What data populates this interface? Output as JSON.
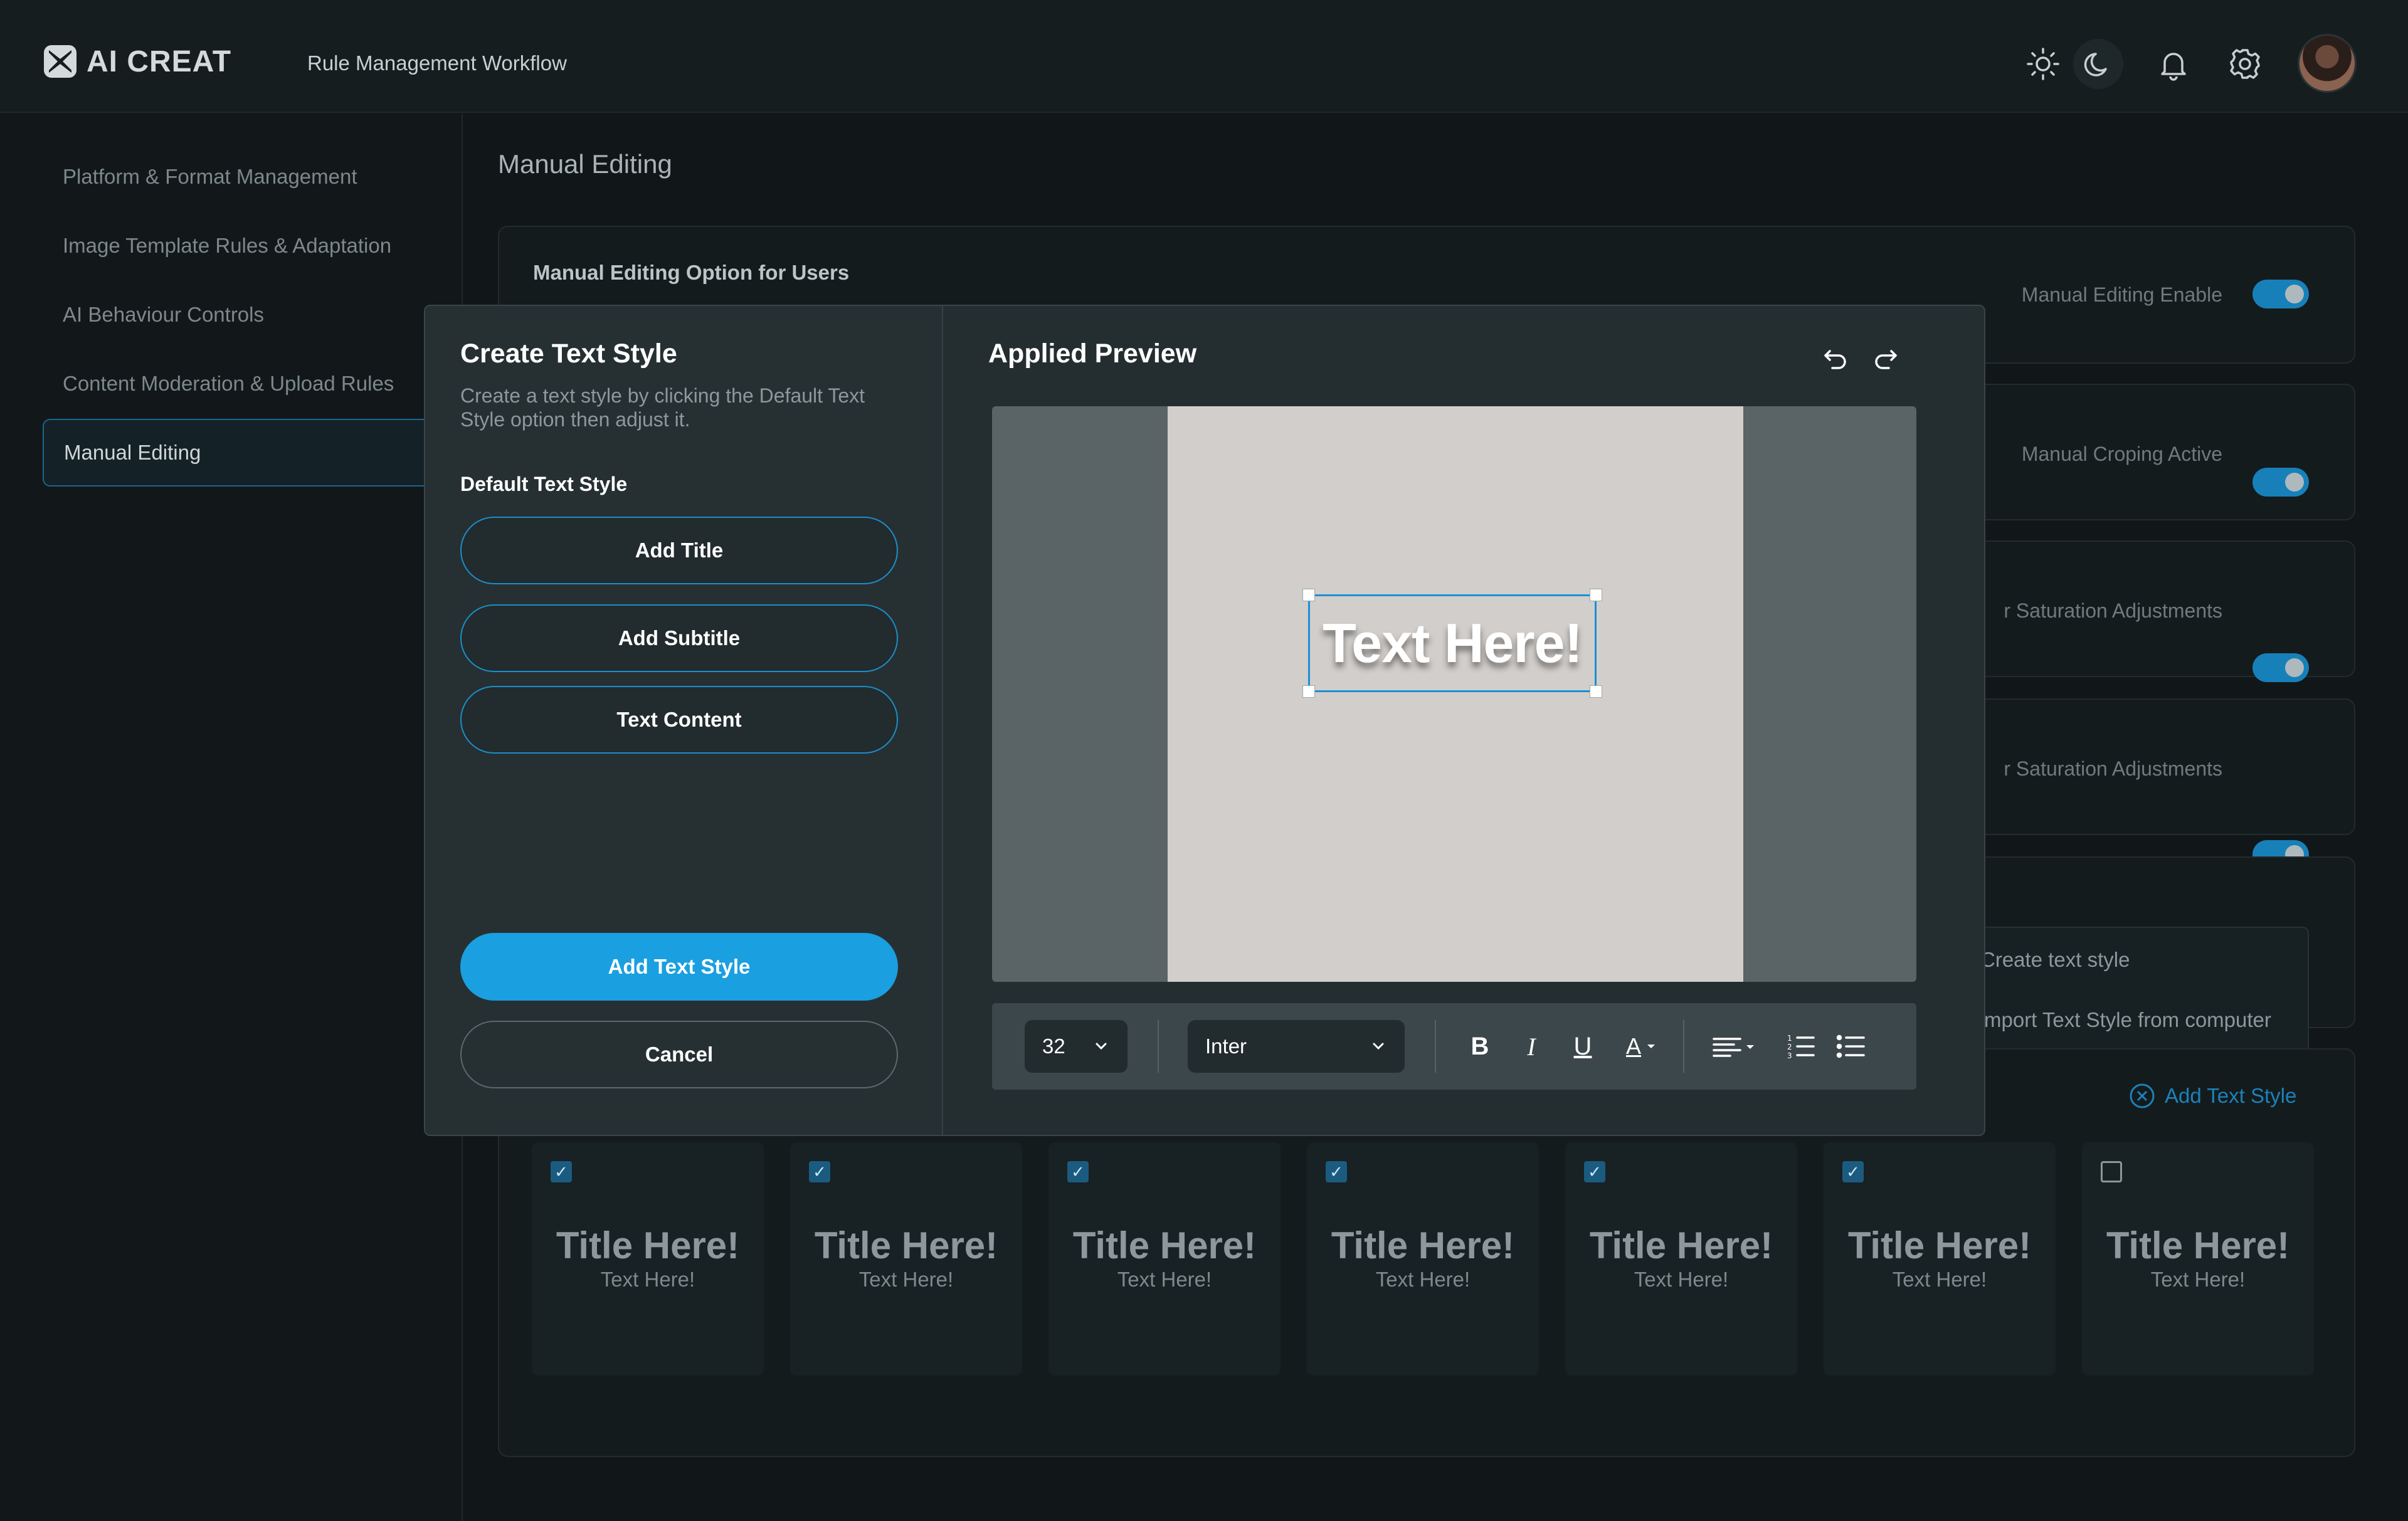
{
  "header": {
    "logo_text": "AI CREAT",
    "app_title": "Rule Management Workflow",
    "icons": [
      "sun-icon",
      "moon-icon",
      "bell-icon",
      "gear-icon"
    ]
  },
  "sidebar": {
    "items": [
      {
        "label": "Platform & Format Management"
      },
      {
        "label": "Image Template Rules & Adaptation"
      },
      {
        "label": "AI Behaviour Controls"
      },
      {
        "label": "Content Moderation & Upload Rules"
      },
      {
        "label": "Manual Editing",
        "active": true
      }
    ]
  },
  "main": {
    "title": "Manual Editing",
    "section_label": "Manual Editing Option for Users",
    "toggles": [
      {
        "label": "Manual Editing Enable",
        "on": true
      },
      {
        "label": "Manual Croping Active",
        "on": true
      },
      {
        "label": "r Saturation Adjustments",
        "on": true
      },
      {
        "label": "r Saturation Adjustments",
        "on": true
      }
    ],
    "menu": {
      "create": "Create text style",
      "import": "mport Text Style from computer"
    },
    "add_text_style_link": "Add Text Style",
    "tiles": [
      {
        "title": "Title Here!",
        "text": "Text Here!",
        "checked": true
      },
      {
        "title": "Title Here!",
        "text": "Text Here!",
        "checked": true
      },
      {
        "title": "Title Here!",
        "text": "Text Here!",
        "checked": true
      },
      {
        "title": "Title Here!",
        "text": "Text Here!",
        "checked": true
      },
      {
        "title": "Title Here!",
        "text": "Text Here!",
        "checked": true
      },
      {
        "title": "Title Here!",
        "text": "Text Here!",
        "checked": true
      },
      {
        "title": "Title Here!",
        "text": "Text Here!",
        "checked": false
      }
    ]
  },
  "modal": {
    "title": "Create Text Style",
    "description": "Create a text style by clicking the Default Text Style option then adjust it.",
    "default_heading": "Default Text Style",
    "buttons": {
      "add_title": "Add Title",
      "add_subtitle": "Add Subtitle",
      "text_content": "Text Content",
      "add_text_style": "Add Text Style",
      "cancel": "Cancel"
    },
    "preview_title": "Applied Preview",
    "preview_text": "Text Here!",
    "toolbar": {
      "font_size": "32",
      "font_family": "Inter",
      "bold": "B",
      "italic": "I",
      "underline": "U",
      "color": "A"
    }
  },
  "colors": {
    "accent": "#1a9fe0",
    "background": "#111718",
    "toggle_on": "#1780b8"
  }
}
